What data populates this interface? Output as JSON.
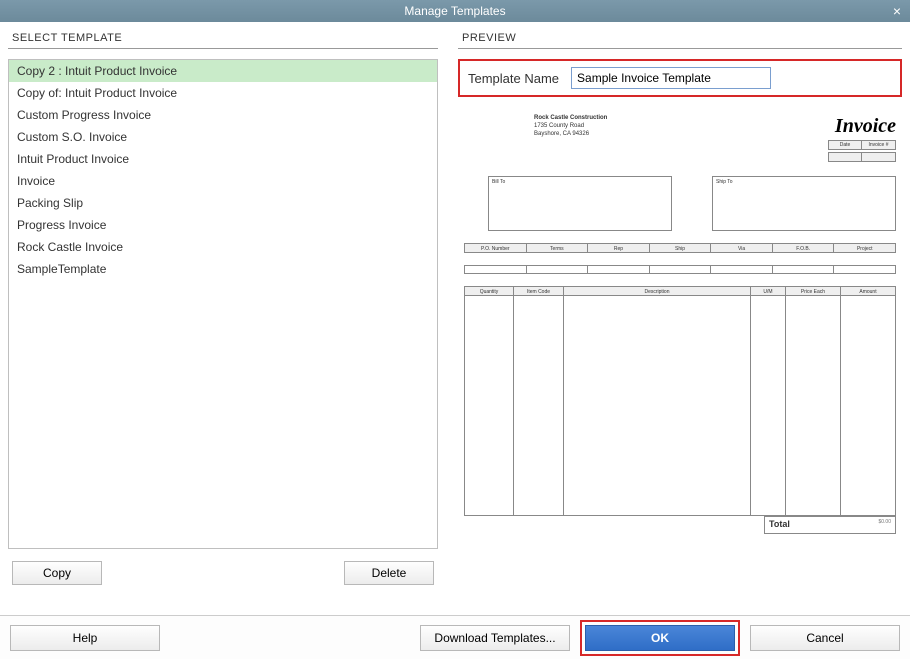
{
  "window": {
    "title": "Manage Templates"
  },
  "left": {
    "header": "SELECT TEMPLATE",
    "items": [
      "Copy 2 : Intuit Product Invoice",
      "Copy of: Intuit Product Invoice",
      "Custom Progress Invoice",
      "Custom S.O. Invoice",
      "Intuit Product Invoice",
      "Invoice",
      "Packing Slip",
      "Progress Invoice",
      "Rock Castle Invoice",
      "SampleTemplate"
    ],
    "selected_index": 0,
    "copy_label": "Copy",
    "delete_label": "Delete"
  },
  "right": {
    "header": "PREVIEW",
    "name_label": "Template Name",
    "name_value": "Sample Invoice Template",
    "doc": {
      "company_name": "Rock Castle Construction",
      "company_addr1": "1735 County Road",
      "company_addr2": "Bayshore, CA 94326",
      "title": "Invoice",
      "date_hdr": "Date",
      "invno_hdr": "Invoice #",
      "bill_to": "Bill To",
      "ship_to": "Ship To",
      "cols1": [
        "P.O. Number",
        "Terms",
        "Rep",
        "Ship",
        "Via",
        "F.O.B.",
        "Project"
      ],
      "cols2": [
        "Quantity",
        "Item Code",
        "Description",
        "U/M",
        "Price Each",
        "Amount"
      ],
      "total_label": "Total",
      "total_amt": "$0.00"
    }
  },
  "footer": {
    "help": "Help",
    "download": "Download Templates...",
    "ok": "OK",
    "cancel": "Cancel"
  }
}
